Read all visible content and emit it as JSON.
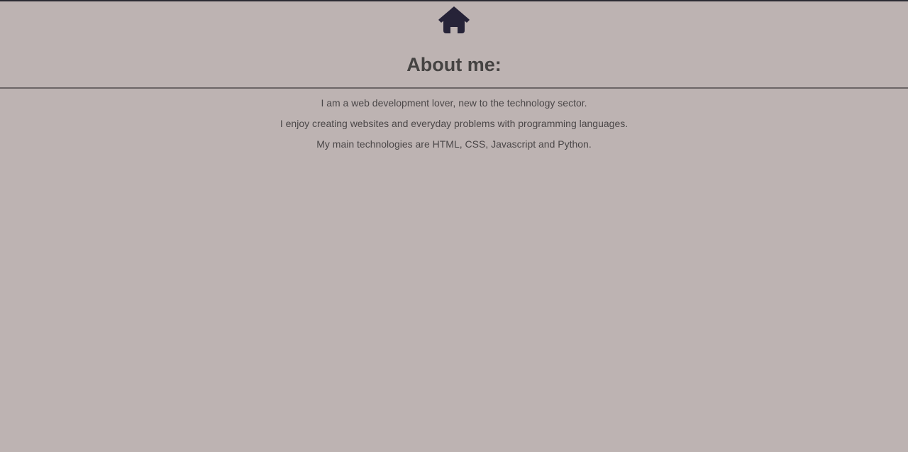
{
  "header": {
    "home_icon": "home-icon",
    "title": "About me:"
  },
  "about": {
    "lines": [
      "I am a web development lover, new to the technology sector.",
      "I enjoy creating websites and everyday problems with programming languages.",
      "My main technologies are HTML, CSS, Javascript and Python."
    ]
  },
  "colors": {
    "background": "#bdb3b2",
    "icon": "#262338",
    "title": "#454342",
    "text": "#4b4748",
    "divider": "#6c6566"
  }
}
